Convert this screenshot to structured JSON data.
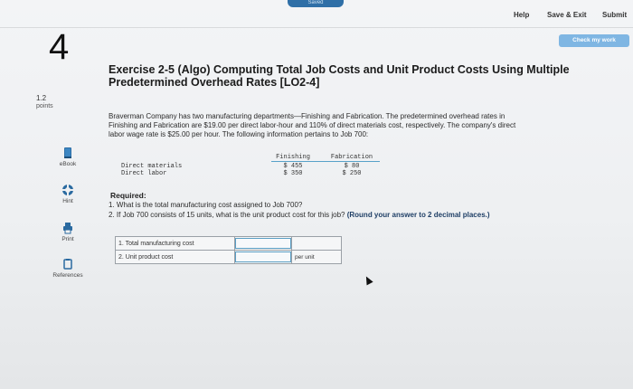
{
  "topbar": {
    "saved_label": "Saved",
    "help_label": "Help",
    "save_exit_label": "Save & Exit",
    "submit_label": "Submit",
    "check_label": "Check my work"
  },
  "question": {
    "number": "4",
    "points_value": "1.2",
    "points_label": "points",
    "title_line1": "Exercise 2-5 (Algo) Computing Total Job Costs and Unit Product Costs Using Multiple",
    "title_line2": "Predetermined Overhead Rates [LO2-4]",
    "description_line1": "Braverman Company has two manufacturing departments—Finishing and Fabrication. The predetermined overhead rates in",
    "description_line2": "Finishing and Fabrication are $19.00 per direct labor-hour and 110% of direct materials cost, respectively. The company's direct",
    "description_line3": "labor wage rate is $25.00 per hour. The following information pertains to Job 700:"
  },
  "sidebar": {
    "tools": [
      {
        "label": "eBook",
        "icon": "ebook-icon"
      },
      {
        "label": "Hint",
        "icon": "hint-icon"
      },
      {
        "label": "Print",
        "icon": "print-icon"
      },
      {
        "label": "References",
        "icon": "references-icon"
      }
    ]
  },
  "job_table": {
    "columns": [
      "Finishing",
      "Fabrication"
    ],
    "rows": [
      {
        "label": "Direct materials",
        "finishing": "$ 455",
        "fabrication": "$ 80"
      },
      {
        "label": "Direct labor",
        "finishing": "$ 350",
        "fabrication": "$ 250"
      }
    ]
  },
  "required": {
    "heading": "Required:",
    "item1": "1. What is the total manufacturing cost assigned to Job 700?",
    "item2_text": "2. If Job 700 consists of 15 units, what is the unit product cost for this job?",
    "item2_note": "(Round your answer to 2 decimal places.)"
  },
  "answers": {
    "rows": [
      {
        "label": "1. Total manufacturing cost",
        "value": "",
        "unit": ""
      },
      {
        "label": "2. Unit product cost",
        "value": "",
        "unit": "per unit"
      }
    ]
  },
  "colors": {
    "accent": "#2f6fa7",
    "check_button": "#7fb6e3",
    "table_header_rule": "#58a2c9"
  }
}
